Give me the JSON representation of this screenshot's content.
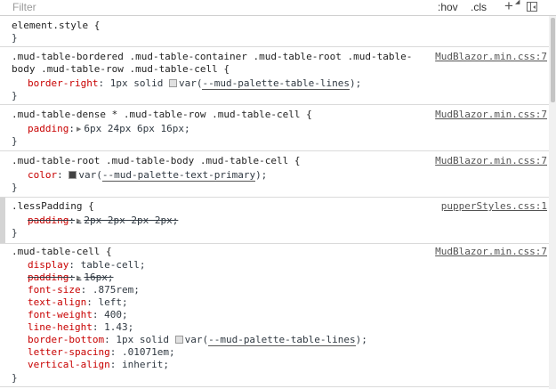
{
  "toolbar": {
    "filter_placeholder": "Filter",
    "hov_label": ":hov",
    "cls_label": ".cls",
    "plus_label": "+",
    "caret": "◢"
  },
  "rules": [
    {
      "selector_lines": [
        "element.style {"
      ],
      "closing": "}",
      "source": "",
      "declarations": []
    },
    {
      "selector_lines": [
        ".mud-table-bordered .mud-table-container .mud-table-root .mud-table-",
        "body .mud-table-row .mud-table-cell {"
      ],
      "closing": "}",
      "source": "MudBlazor.min.css:7",
      "declarations": [
        {
          "name": "border-right",
          "before": "1px solid ",
          "swatch": "#e0e0e0",
          "var": "--mud-palette-table-lines",
          "after": ");"
        }
      ]
    },
    {
      "selector_lines": [
        ".mud-table-dense * .mud-table-row .mud-table-cell {"
      ],
      "closing": "}",
      "source": "MudBlazor.min.css:7",
      "declarations": [
        {
          "name": "padding",
          "value": "6px 24px 6px 16px;"
        }
      ]
    },
    {
      "selector_lines": [
        ".mud-table-root .mud-table-body .mud-table-cell {"
      ],
      "closing": "}",
      "source": "MudBlazor.min.css:7",
      "declarations": [
        {
          "name": "color",
          "swatch": "#424242",
          "var": "--mud-palette-text-primary",
          "after": ");"
        }
      ]
    },
    {
      "selector_lines": [
        ".lessPadding {"
      ],
      "closing": "}",
      "source": "pupperStyles.css:1",
      "declarations": [
        {
          "name": "padding",
          "value": "2px 2px 2px 2px;"
        }
      ]
    },
    {
      "selector_lines": [
        ".mud-table-cell {"
      ],
      "closing": "}",
      "source": "MudBlazor.min.css:7",
      "declarations": [
        {
          "name": "display",
          "value": "table-cell;"
        },
        {
          "name": "padding",
          "value": "16px;"
        },
        {
          "name": "font-size",
          "value": ".875rem;"
        },
        {
          "name": "text-align",
          "value": "left;"
        },
        {
          "name": "font-weight",
          "value": "400;"
        },
        {
          "name": "line-height",
          "value": "1.43;"
        },
        {
          "name": "border-bottom",
          "before": "1px solid ",
          "swatch": "#e0e0e0",
          "var": "--mud-palette-table-lines",
          "after": ");"
        },
        {
          "name": "letter-spacing",
          "value": ".01071em;"
        },
        {
          "name": "vertical-align",
          "value": "inherit;"
        }
      ]
    }
  ],
  "colors": {
    "property_name": "#c80000",
    "source_link": "#545454",
    "swatch_border": "#999999"
  }
}
